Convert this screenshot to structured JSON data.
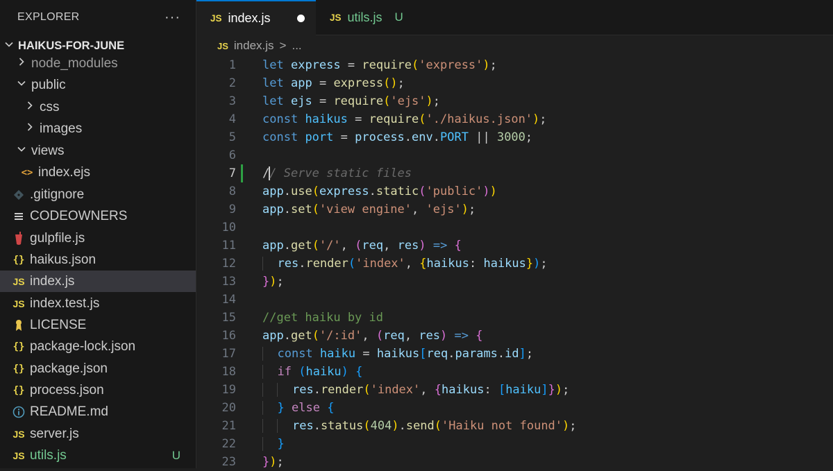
{
  "sidebar": {
    "header": "EXPLORER",
    "more": "···",
    "project": "HAIKUS-FOR-JUNE",
    "items": [
      {
        "label": "node_modules",
        "kind": "folder-collapsed"
      },
      {
        "label": "public",
        "kind": "folder-expanded"
      },
      {
        "label": "css",
        "kind": "folder-collapsed"
      },
      {
        "label": "images",
        "kind": "folder-collapsed"
      },
      {
        "label": "views",
        "kind": "folder-expanded"
      },
      {
        "label": "index.ejs",
        "icon": "<>"
      },
      {
        "label": ".gitignore",
        "icon": "git-icon"
      },
      {
        "label": "CODEOWNERS",
        "icon": "lines-icon"
      },
      {
        "label": "gulpfile.js",
        "icon": "gulp-icon"
      },
      {
        "label": "haikus.json",
        "icon": "{}"
      },
      {
        "label": "index.js",
        "icon": "JS",
        "selected": true
      },
      {
        "label": "index.test.js",
        "icon": "JS"
      },
      {
        "label": "LICENSE",
        "icon": "license-icon"
      },
      {
        "label": "package-lock.json",
        "icon": "{}"
      },
      {
        "label": "package.json",
        "icon": "{}"
      },
      {
        "label": "process.json",
        "icon": "{}"
      },
      {
        "label": "README.md",
        "icon": "info-icon"
      },
      {
        "label": "server.js",
        "icon": "JS"
      },
      {
        "label": "utils.js",
        "icon": "JS",
        "badge": "U"
      }
    ]
  },
  "tabs": [
    {
      "icon": "JS",
      "label": "index.js",
      "active": true,
      "dirty": true
    },
    {
      "icon": "JS",
      "label": "utils.js",
      "badge": "U"
    }
  ],
  "breadcrumb": {
    "icon": "JS",
    "file": "index.js",
    "sep": ">",
    "rest": "..."
  },
  "editor": {
    "line_numbers": [
      "1",
      "2",
      "3",
      "4",
      "5",
      "6",
      "7",
      "8",
      "9",
      "10",
      "11",
      "12",
      "13",
      "14",
      "15",
      "16",
      "17",
      "18",
      "19",
      "20",
      "21",
      "22",
      "23"
    ],
    "current_line": 7
  },
  "colors": {
    "accent": "#0078d4",
    "git_added": "#2ea043",
    "untracked": "#73c991"
  }
}
